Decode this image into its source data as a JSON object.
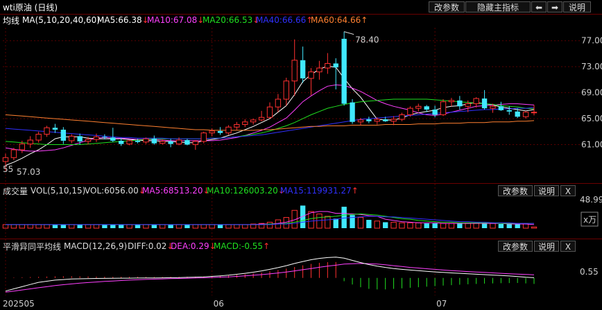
{
  "window": {
    "title": "wti原油 (日线)",
    "buttons": {
      "edit": "改参数",
      "hide": "隐藏主指标",
      "left": "⬅",
      "right": "➡",
      "help": "说明"
    }
  },
  "main_panel": {
    "name": "均线",
    "params": "MA(5,10,20,40,60)",
    "legend": [
      {
        "text": "MA5:66.38",
        "arrow": "↓",
        "color": "#ffffff"
      },
      {
        "text": "MA10:67.08",
        "arrow": "↓",
        "color": "#ff40ff"
      },
      {
        "text": "MA20:66.53",
        "arrow": "↓",
        "color": "#20e020"
      },
      {
        "text": "MA40:66.66",
        "arrow": "↑",
        "color": "#3030ff"
      },
      {
        "text": "MA60:64.66",
        "arrow": "↑",
        "color": "#ff8030"
      }
    ],
    "high_label": "78.40",
    "low_label": "57.03",
    "left_mark": "55"
  },
  "volume_panel": {
    "name": "成交量",
    "params": "VOL(5,10,15)",
    "legend": [
      {
        "text": "VOL:6056.00",
        "arrow": "↓",
        "color": "#dddddd"
      },
      {
        "text": "MA5:68513.20",
        "arrow": "↓",
        "color": "#ff40ff"
      },
      {
        "text": "MA10:126003.20",
        "arrow": "↓",
        "color": "#20e020"
      },
      {
        "text": "MA15:119931.27",
        "arrow": "↑",
        "color": "#3030ff"
      }
    ],
    "buttons": {
      "edit": "改参数",
      "help": "说明",
      "close": "X"
    },
    "axis_top": "48.99",
    "unit": "x万"
  },
  "macd_panel": {
    "name": "平滑异同平均线",
    "params": "MACD(12,26,9)",
    "legend": [
      {
        "text": "DIFF:0.02",
        "arrow": "↓",
        "color": "#dddddd"
      },
      {
        "text": "DEA:0.29",
        "arrow": "↓",
        "color": "#ff40ff"
      },
      {
        "text": "MACD:-0.55",
        "arrow": "↑",
        "color": "#20e020"
      }
    ],
    "buttons": {
      "edit": "改参数",
      "help": "说明",
      "close": "X"
    },
    "axis_label": "0.55"
  },
  "x_axis": {
    "labels": [
      "202505",
      "06",
      "07"
    ]
  },
  "chart_data": [
    {
      "type": "candlestick",
      "title": "wti原油 (日线)",
      "y_ticks": [
        61,
        65,
        69,
        73,
        77
      ],
      "ylim": [
        57,
        79
      ],
      "grid": true,
      "x_labels": {
        "202505": 0,
        "06": 25,
        "07": 52
      },
      "ohlc": [
        [
          58.4,
          59.6,
          57.0,
          59.0
        ],
        [
          59.0,
          60.5,
          58.6,
          60.2
        ],
        [
          60.2,
          61.6,
          59.7,
          61.1
        ],
        [
          61.1,
          62.3,
          60.5,
          61.7
        ],
        [
          61.7,
          63.0,
          61.3,
          62.6
        ],
        [
          62.6,
          63.9,
          62.2,
          63.6
        ],
        [
          63.6,
          64.2,
          62.8,
          63.3
        ],
        [
          63.3,
          63.7,
          61.1,
          61.6
        ],
        [
          61.6,
          62.6,
          61.2,
          62.3
        ],
        [
          62.3,
          62.7,
          61.0,
          61.5
        ],
        [
          61.5,
          62.2,
          61.0,
          61.8
        ],
        [
          61.8,
          62.7,
          61.4,
          62.2
        ],
        [
          62.2,
          62.6,
          61.8,
          62.1
        ],
        [
          62.1,
          63.6,
          61.4,
          61.6
        ],
        [
          61.6,
          62.0,
          60.8,
          61.1
        ],
        [
          61.1,
          61.7,
          60.9,
          61.6
        ],
        [
          61.6,
          61.9,
          61.2,
          61.4
        ],
        [
          61.4,
          62.1,
          61.1,
          61.9
        ],
        [
          61.9,
          62.4,
          61.0,
          61.2
        ],
        [
          61.2,
          61.8,
          61.0,
          61.5
        ],
        [
          61.5,
          61.9,
          60.6,
          61.1
        ],
        [
          61.1,
          62.1,
          60.9,
          61.7
        ],
        [
          61.7,
          61.9,
          60.9,
          61.0
        ],
        [
          61.0,
          61.7,
          60.2,
          61.5
        ],
        [
          61.5,
          63.0,
          61.2,
          62.8
        ],
        [
          62.8,
          63.5,
          62.3,
          63.1
        ],
        [
          63.1,
          63.7,
          62.5,
          62.8
        ],
        [
          62.8,
          64.0,
          62.5,
          63.7
        ],
        [
          63.7,
          64.5,
          63.3,
          64.1
        ],
        [
          64.1,
          64.9,
          63.7,
          64.5
        ],
        [
          64.5,
          65.0,
          64.1,
          64.8
        ],
        [
          64.8,
          66.2,
          64.6,
          65.2
        ],
        [
          65.2,
          67.5,
          65.0,
          66.8
        ],
        [
          66.8,
          68.8,
          66.0,
          68.0
        ],
        [
          68.0,
          71.3,
          67.0,
          70.8
        ],
        [
          70.8,
          77.2,
          68.5,
          74.0
        ],
        [
          74.0,
          76.1,
          70.5,
          71.2
        ],
        [
          71.2,
          72.8,
          68.6,
          72.2
        ],
        [
          72.2,
          73.9,
          71.0,
          72.8
        ],
        [
          72.8,
          75.1,
          71.9,
          73.5
        ],
        [
          73.5,
          74.3,
          69.5,
          72.9
        ],
        [
          77.3,
          78.4,
          67.0,
          67.3
        ],
        [
          67.5,
          68.0,
          64.2,
          64.5
        ],
        [
          64.5,
          65.1,
          64.0,
          64.8
        ],
        [
          64.9,
          65.3,
          64.3,
          64.6
        ],
        [
          64.6,
          65.2,
          64.1,
          64.9
        ],
        [
          64.9,
          65.3,
          64.5,
          64.6
        ],
        [
          64.6,
          65.4,
          64.0,
          64.9
        ],
        [
          64.9,
          65.9,
          64.6,
          65.6
        ],
        [
          65.6,
          66.9,
          65.3,
          66.6
        ],
        [
          66.6,
          67.3,
          66.1,
          66.9
        ],
        [
          66.9,
          67.1,
          66.0,
          66.4
        ],
        [
          66.4,
          67.0,
          65.2,
          65.6
        ],
        [
          65.6,
          68.0,
          65.4,
          67.6
        ],
        [
          67.6,
          68.2,
          66.9,
          67.8
        ],
        [
          67.8,
          68.5,
          66.4,
          66.9
        ],
        [
          66.9,
          67.8,
          66.0,
          67.3
        ],
        [
          67.3,
          68.3,
          66.7,
          68.1
        ],
        [
          68.1,
          69.4,
          66.4,
          66.6
        ],
        [
          66.6,
          67.3,
          65.9,
          66.9
        ],
        [
          66.9,
          67.6,
          66.2,
          66.3
        ],
        [
          66.3,
          66.9,
          65.6,
          66.1
        ],
        [
          66.1,
          66.6,
          65.1,
          65.3
        ],
        [
          65.3,
          66.2,
          65.0,
          66.0
        ],
        [
          66.0,
          67.1,
          65.5,
          66.0
        ]
      ],
      "ma": {
        "MA5": [
          57.8,
          58.3,
          58.9,
          59.6,
          60.2,
          61.0,
          61.9,
          62.2,
          62.2,
          62.2,
          62.0,
          61.9,
          61.9,
          61.9,
          61.9,
          61.8,
          61.7,
          61.6,
          61.6,
          61.5,
          61.5,
          61.4,
          61.3,
          61.3,
          61.6,
          61.8,
          62.0,
          62.4,
          62.8,
          63.3,
          63.8,
          64.4,
          65.0,
          66.0,
          67.0,
          68.7,
          70.7,
          71.8,
          72.6,
          73.1,
          72.9,
          71.2,
          69.6,
          68.3,
          66.6,
          64.9,
          64.8,
          64.8,
          65.1,
          65.6,
          65.9,
          66.1,
          66.3,
          66.7,
          66.9,
          67.0,
          67.3,
          67.5,
          67.3,
          67.1,
          66.8,
          66.6,
          66.4,
          66.2,
          66.4
        ],
        "MA10": [
          60.5,
          60.3,
          60.1,
          60.0,
          60.0,
          60.1,
          60.2,
          60.5,
          60.9,
          61.3,
          61.7,
          62.0,
          62.1,
          62.0,
          62.0,
          61.9,
          61.8,
          61.8,
          61.8,
          61.7,
          61.6,
          61.6,
          61.6,
          61.6,
          61.6,
          61.6,
          61.7,
          61.9,
          62.1,
          62.4,
          62.8,
          63.2,
          63.7,
          64.4,
          65.1,
          66.3,
          67.6,
          68.5,
          69.3,
          70.0,
          70.2,
          70.1,
          69.7,
          69.2,
          68.5,
          67.8,
          67.3,
          66.9,
          66.6,
          66.3,
          65.9,
          65.6,
          65.5,
          65.7,
          66.0,
          66.3,
          66.6,
          66.9,
          67.0,
          67.1,
          67.2,
          67.3,
          67.3,
          67.2,
          67.1
        ],
        "MA20": [
          61.5,
          61.4,
          61.3,
          61.2,
          61.1,
          61.0,
          61.0,
          61.0,
          61.0,
          61.0,
          61.1,
          61.2,
          61.3,
          61.4,
          61.5,
          61.6,
          61.7,
          61.8,
          61.9,
          61.9,
          61.9,
          61.9,
          61.9,
          61.9,
          61.9,
          62.0,
          62.0,
          62.1,
          62.2,
          62.4,
          62.6,
          62.8,
          63.1,
          63.5,
          63.9,
          64.4,
          65.0,
          65.6,
          66.1,
          66.6,
          66.9,
          67.2,
          67.4,
          67.6,
          67.7,
          67.8,
          67.9,
          68.0,
          68.0,
          68.0,
          68.0,
          68.0,
          67.9,
          67.8,
          67.7,
          67.6,
          67.5,
          67.4,
          67.3,
          67.2,
          67.0,
          66.9,
          66.8,
          66.6,
          66.5
        ],
        "MA40": [
          63.5,
          63.4,
          63.3,
          63.2,
          63.1,
          63.0,
          62.9,
          62.8,
          62.7,
          62.6,
          62.5,
          62.4,
          62.3,
          62.2,
          62.1,
          62.1,
          62.0,
          62.0,
          62.0,
          62.0,
          61.9,
          61.9,
          61.9,
          61.9,
          61.9,
          62.0,
          62.0,
          62.1,
          62.2,
          62.3,
          62.4,
          62.5,
          62.7,
          62.9,
          63.1,
          63.3,
          63.5,
          63.7,
          63.9,
          64.1,
          64.3,
          64.5,
          64.7,
          64.9,
          65.0,
          65.1,
          65.2,
          65.3,
          65.4,
          65.5,
          65.6,
          65.7,
          65.8,
          65.9,
          66.0,
          66.1,
          66.2,
          66.3,
          66.4,
          66.4,
          66.5,
          66.5,
          66.6,
          66.6,
          66.7
        ],
        "MA60": [
          65.6,
          65.5,
          65.4,
          65.3,
          65.2,
          65.1,
          65.0,
          64.9,
          64.8,
          64.7,
          64.6,
          64.5,
          64.4,
          64.3,
          64.2,
          64.1,
          64.0,
          63.9,
          63.8,
          63.7,
          63.6,
          63.5,
          63.4,
          63.3,
          63.3,
          63.2,
          63.2,
          63.2,
          63.2,
          63.2,
          63.2,
          63.3,
          63.3,
          63.4,
          63.5,
          63.6,
          63.7,
          63.8,
          63.8,
          63.9,
          63.9,
          63.9,
          64.0,
          64.0,
          64.0,
          64.0,
          64.1,
          64.1,
          64.1,
          64.1,
          64.2,
          64.2,
          64.2,
          64.3,
          64.3,
          64.3,
          64.4,
          64.4,
          64.4,
          64.5,
          64.5,
          64.5,
          64.6,
          64.6,
          64.7
        ]
      }
    },
    {
      "type": "bar",
      "title": "成交量",
      "ylim": [
        0,
        48.99
      ],
      "unit": "万",
      "values": [
        6,
        6,
        6,
        6,
        6,
        6,
        6,
        6,
        6,
        6,
        6,
        6,
        6,
        6,
        6,
        6,
        6,
        6,
        6,
        6,
        6,
        6,
        6,
        6,
        6,
        6,
        6,
        6,
        6,
        6,
        7,
        8,
        10,
        14,
        18,
        30,
        38,
        28,
        24,
        20,
        16,
        36,
        22,
        18,
        14,
        12,
        10,
        10,
        9,
        9,
        9,
        8,
        8,
        8,
        8,
        8,
        8,
        8,
        8,
        8,
        7,
        7,
        7,
        7,
        2
      ],
      "ma5": [
        6,
        6,
        6,
        6,
        6,
        6,
        6,
        6,
        6,
        6,
        6,
        6,
        6,
        6,
        6,
        6,
        6,
        6,
        6,
        6,
        6,
        6,
        6,
        6,
        6,
        6,
        6,
        6,
        6,
        6,
        6,
        7,
        7,
        8,
        10,
        14,
        20,
        26,
        28,
        28,
        25,
        25,
        24,
        23,
        21,
        20,
        15,
        13,
        11,
        10,
        9,
        9,
        9,
        8,
        8,
        8,
        8,
        8,
        8,
        8,
        8,
        7,
        7,
        7,
        6
      ],
      "ma10": [
        6,
        6,
        6,
        6,
        6,
        6,
        6,
        6,
        6,
        6,
        6,
        6,
        6,
        6,
        6,
        6,
        6,
        6,
        6,
        6,
        6,
        6,
        6,
        6,
        6,
        6,
        6,
        6,
        6,
        6,
        6,
        6,
        7,
        7,
        8,
        10,
        13,
        16,
        18,
        19,
        20,
        22,
        23,
        24,
        23,
        22,
        20,
        18,
        16,
        15,
        13,
        12,
        11,
        10,
        10,
        9,
        9,
        9,
        9,
        9,
        8,
        8,
        8,
        8,
        8
      ],
      "ma15": [
        6,
        6,
        6,
        6,
        6,
        6,
        6,
        6,
        6,
        6,
        6,
        6,
        6,
        6,
        6,
        6,
        6,
        6,
        6,
        6,
        6,
        6,
        6,
        6,
        6,
        6,
        6,
        6,
        6,
        6,
        6,
        6,
        6,
        7,
        7,
        8,
        10,
        12,
        13,
        14,
        15,
        17,
        18,
        19,
        20,
        20,
        19,
        19,
        18,
        17,
        16,
        15,
        14,
        13,
        12,
        11,
        11,
        10,
        10,
        9,
        9,
        9,
        8,
        8,
        8
      ]
    },
    {
      "type": "macd",
      "title": "平滑异同平均线",
      "ylim": [
        -1.6,
        2.2
      ],
      "hist": [
        0.02,
        0.04,
        0.06,
        0.08,
        0.1,
        0.12,
        0.14,
        0.15,
        0.15,
        0.14,
        0.13,
        0.12,
        0.11,
        0.1,
        0.1,
        0.1,
        0.1,
        0.09,
        0.09,
        0.09,
        0.1,
        0.1,
        0.11,
        0.12,
        0.13,
        0.15,
        0.18,
        0.22,
        0.28,
        0.34,
        0.42,
        0.5,
        0.6,
        0.72,
        0.85,
        1.0,
        1.15,
        1.28,
        1.38,
        1.44,
        1.45,
        -0.3,
        -0.6,
        -0.85,
        -1.0,
        -1.05,
        -1.05,
        -1.0,
        -0.95,
        -0.9,
        -0.85,
        -0.8,
        -0.75,
        -0.7,
        -0.66,
        -0.62,
        -0.58,
        -0.55,
        -0.52,
        -0.5,
        -0.48,
        -0.47,
        -0.46,
        -0.5,
        -0.55
      ],
      "diff": [
        -1.2,
        -1.0,
        -0.8,
        -0.6,
        -0.4,
        -0.3,
        -0.2,
        -0.15,
        -0.1,
        -0.08,
        -0.06,
        -0.05,
        -0.04,
        -0.03,
        -0.02,
        -0.02,
        -0.01,
        0.0,
        0.0,
        0.01,
        0.02,
        0.03,
        0.05,
        0.07,
        0.1,
        0.14,
        0.19,
        0.25,
        0.33,
        0.42,
        0.52,
        0.64,
        0.78,
        0.94,
        1.12,
        1.32,
        1.5,
        1.66,
        1.78,
        1.86,
        1.9,
        1.8,
        1.6,
        1.4,
        1.22,
        1.08,
        0.96,
        0.86,
        0.78,
        0.72,
        0.66,
        0.6,
        0.55,
        0.5,
        0.46,
        0.42,
        0.38,
        0.34,
        0.3,
        0.26,
        0.22,
        0.18,
        0.12,
        0.06,
        0.02
      ],
      "dea": [
        -1.3,
        -1.2,
        -1.1,
        -1.0,
        -0.9,
        -0.8,
        -0.7,
        -0.62,
        -0.55,
        -0.48,
        -0.42,
        -0.37,
        -0.32,
        -0.28,
        -0.24,
        -0.2,
        -0.17,
        -0.14,
        -0.11,
        -0.09,
        -0.07,
        -0.05,
        -0.03,
        -0.01,
        0.01,
        0.04,
        0.07,
        0.1,
        0.14,
        0.19,
        0.24,
        0.3,
        0.37,
        0.45,
        0.54,
        0.64,
        0.75,
        0.86,
        0.97,
        1.07,
        1.16,
        1.26,
        1.3,
        1.32,
        1.3,
        1.26,
        1.2,
        1.12,
        1.04,
        0.96,
        0.9,
        0.84,
        0.78,
        0.72,
        0.67,
        0.62,
        0.58,
        0.54,
        0.5,
        0.46,
        0.42,
        0.38,
        0.35,
        0.32,
        0.29
      ]
    }
  ]
}
